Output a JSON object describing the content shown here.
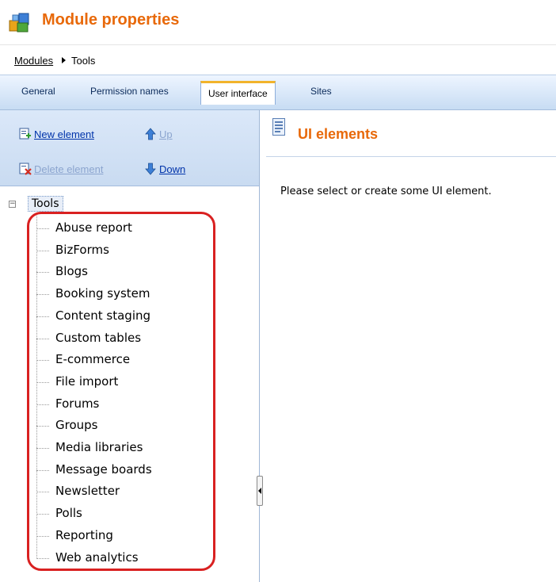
{
  "window": {
    "title": "Module properties",
    "icon": "module-properties-icon",
    "accent_color": "#e8690a"
  },
  "breadcrumb": {
    "parent": "Modules",
    "current": "Tools"
  },
  "tabs": [
    {
      "label": "General",
      "active": false
    },
    {
      "label": "Permission names",
      "active": false
    },
    {
      "label": "User interface",
      "active": true
    },
    {
      "label": "Sites",
      "active": false
    }
  ],
  "toolbar": {
    "new_element": {
      "label": "New element",
      "icon": "new-element-icon",
      "enabled": true
    },
    "up": {
      "label": "Up",
      "icon": "up-arrow-icon",
      "enabled": false
    },
    "delete_element": {
      "label": "Delete element",
      "icon": "delete-element-icon",
      "enabled": false
    },
    "down": {
      "label": "Down",
      "icon": "down-arrow-icon",
      "enabled": true
    }
  },
  "tree": {
    "root": {
      "label": "Tools",
      "expanded": true
    },
    "items": [
      "Abuse report",
      "BizForms",
      "Blogs",
      "Booking system",
      "Content staging",
      "Custom tables",
      "E-commerce",
      "File import",
      "Forums",
      "Groups",
      "Media libraries",
      "Message boards",
      "Newsletter",
      "Polls",
      "Reporting",
      "Web analytics"
    ],
    "highlight_color": "#d92121"
  },
  "right_panel": {
    "title": "UI elements",
    "icon": "ui-elements-icon",
    "message": "Please select or create some UI element."
  }
}
